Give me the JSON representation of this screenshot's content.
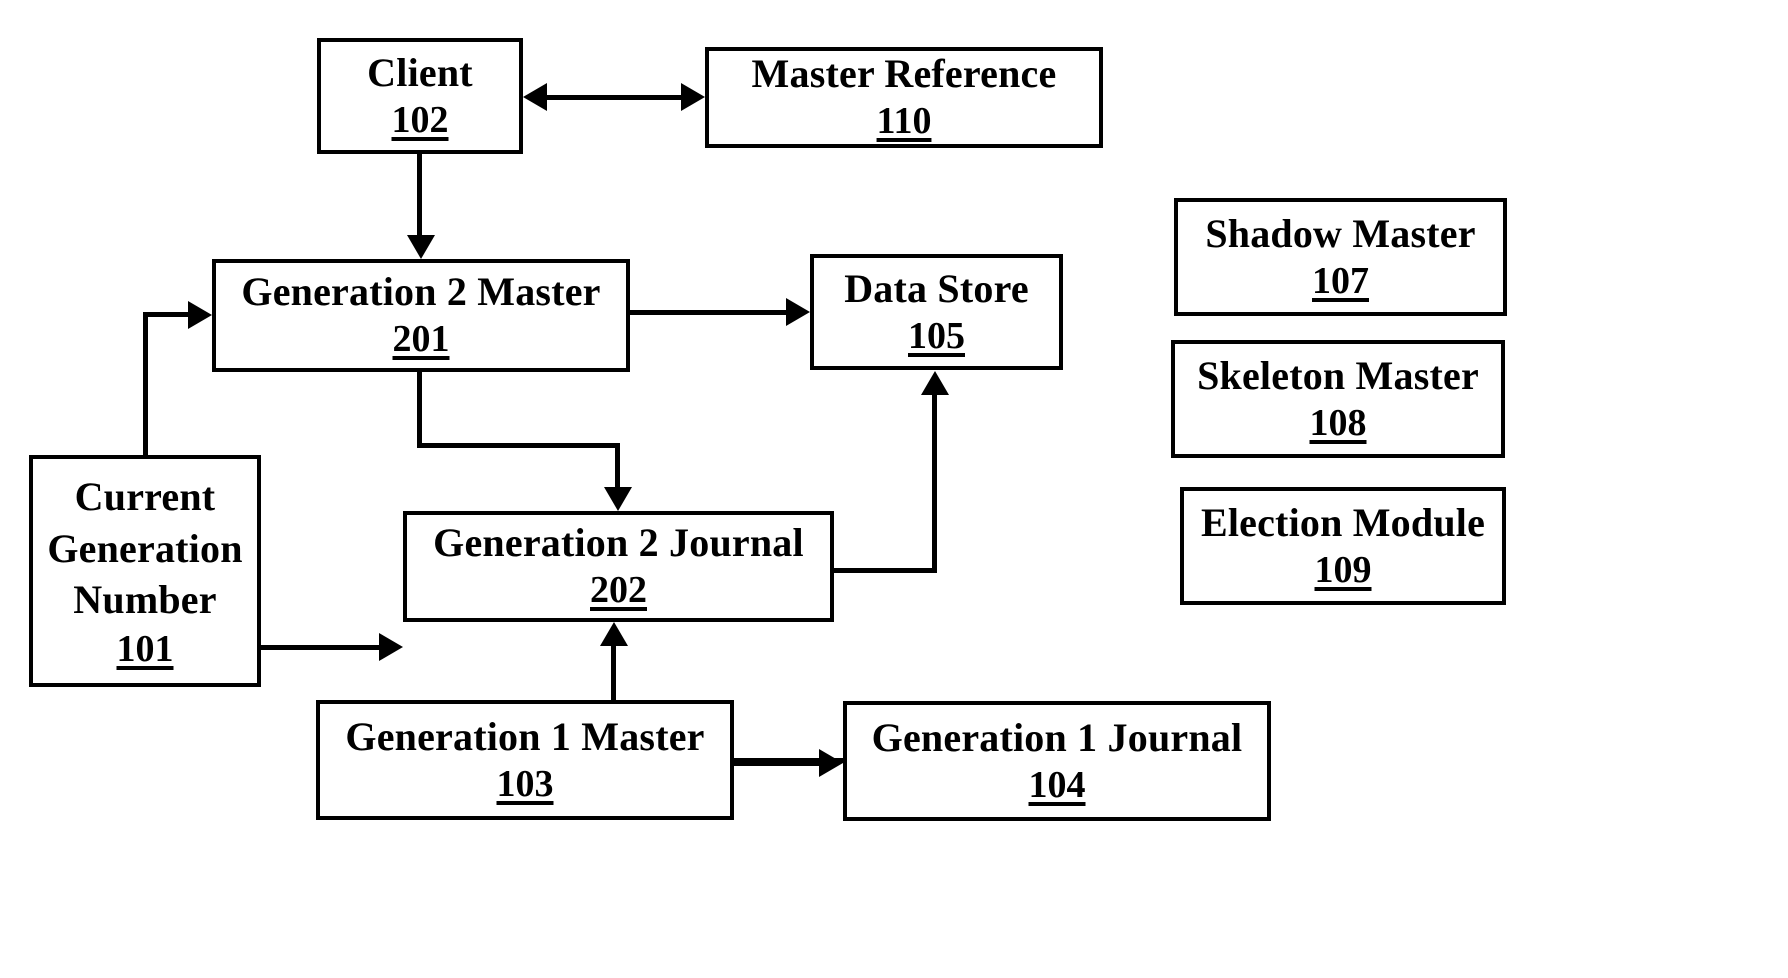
{
  "figure": {
    "type": "patent-block-diagram",
    "background_color": "#ffffff",
    "line_color": "#000000"
  },
  "nodes": {
    "client": {
      "title": "Client",
      "ref": "102"
    },
    "master_reference": {
      "title": "Master Reference",
      "ref": "110"
    },
    "generation_2_master": {
      "title": "Generation 2 Master",
      "ref": "201"
    },
    "data_store": {
      "title": "Data Store",
      "ref": "105"
    },
    "current_generation_number": {
      "title": "Current\nGeneration\nNumber",
      "ref": "101"
    },
    "generation_2_journal": {
      "title": "Generation 2 Journal",
      "ref": "202"
    },
    "generation_1_master": {
      "title": "Generation 1 Master",
      "ref": "103"
    },
    "generation_1_journal": {
      "title": "Generation 1 Journal",
      "ref": "104"
    },
    "shadow_master": {
      "title": "Shadow Master",
      "ref": "107"
    },
    "skeleton_master": {
      "title": "Skeleton Master",
      "ref": "108"
    },
    "election_module": {
      "title": "Election Module",
      "ref": "109"
    }
  },
  "connections": [
    {
      "name": "client-to-master-reference",
      "from": "client",
      "to": "master_reference",
      "style": "bidirectional"
    },
    {
      "name": "client-to-generation-2-master",
      "from": "client",
      "to": "generation_2_master",
      "style": "directed"
    },
    {
      "name": "generation-2-master-to-data-store",
      "from": "generation_2_master",
      "to": "data_store",
      "style": "directed"
    },
    {
      "name": "generation-2-master-to-generation-2-journal",
      "from": "generation_2_master",
      "to": "generation_2_journal",
      "style": "directed"
    },
    {
      "name": "current-generation-number-to-generation-2-master",
      "from": "current_generation_number",
      "to": "generation_2_master",
      "style": "directed"
    },
    {
      "name": "current-generation-number-to-generation-2-journal",
      "from": "current_generation_number",
      "to": "generation_2_journal",
      "style": "directed"
    },
    {
      "name": "generation-2-journal-to-data-store",
      "from": "generation_2_journal",
      "to": "data_store",
      "style": "directed"
    },
    {
      "name": "generation-1-master-to-generation-1-journal",
      "from": "generation_1_master",
      "to": "generation_1_journal",
      "style": "directed"
    },
    {
      "name": "generation-1-journal-to-generation-2-journal",
      "from": "generation_1_journal",
      "to": "generation_2_journal",
      "style": "directed"
    }
  ]
}
